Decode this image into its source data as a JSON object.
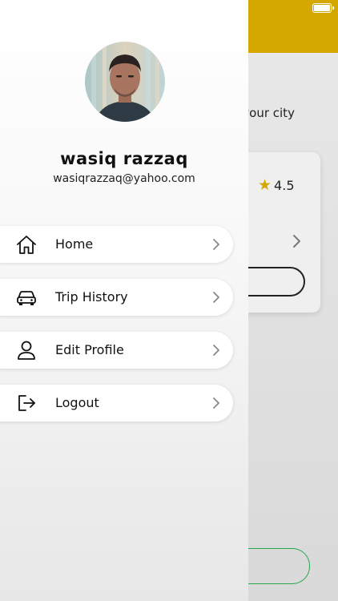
{
  "background": {
    "tagline": "n your city",
    "rating": "4.5",
    "star": "★",
    "accent_color": "#d4a800",
    "button_outline_color": "#27a64a"
  },
  "drawer": {
    "user": {
      "name": "wasiq razzaq",
      "email": "wasiqrazzaq@yahoo.com"
    },
    "menu": [
      {
        "label": "Home",
        "icon": "home-icon"
      },
      {
        "label": "Trip History",
        "icon": "car-icon"
      },
      {
        "label": "Edit Profile",
        "icon": "user-icon"
      },
      {
        "label": "Logout",
        "icon": "logout-icon"
      }
    ]
  }
}
